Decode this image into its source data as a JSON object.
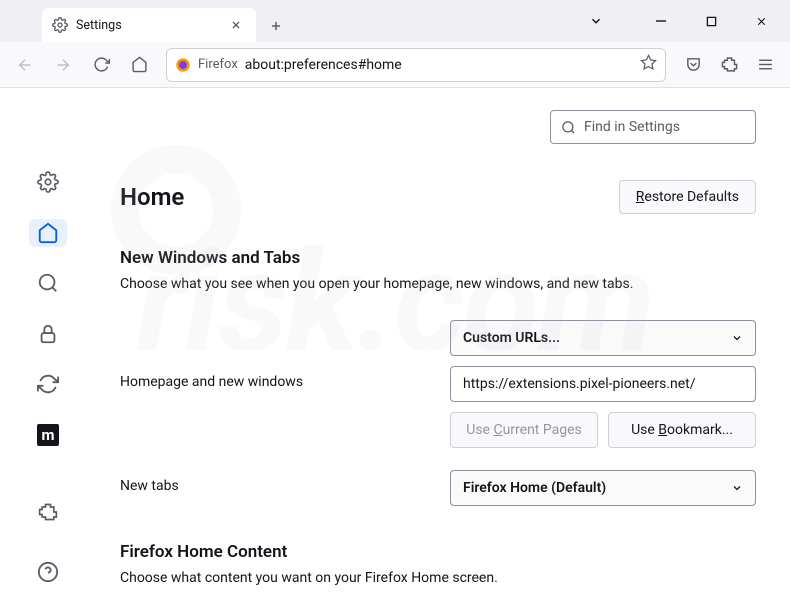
{
  "tab": {
    "label": "Settings"
  },
  "address": {
    "prefix": "Firefox",
    "url": "about:preferences#home"
  },
  "search": {
    "placeholder": "Find in Settings"
  },
  "page": {
    "title": "Home",
    "restore": "Restore Defaults"
  },
  "section1": {
    "title": "New Windows and Tabs",
    "desc": "Choose what you see when you open your homepage, new windows, and new tabs."
  },
  "homepage": {
    "label": "Homepage and new windows",
    "select": "Custom URLs...",
    "url": "https://extensions.pixel-pioneers.net/",
    "useCurrentPages": "Use Current Pages",
    "useBookmark": "Use Bookmark..."
  },
  "newtabs": {
    "label": "New tabs",
    "select": "Firefox Home (Default)"
  },
  "section2": {
    "title": "Firefox Home Content",
    "desc": "Choose what content you want on your Firefox Home screen."
  }
}
